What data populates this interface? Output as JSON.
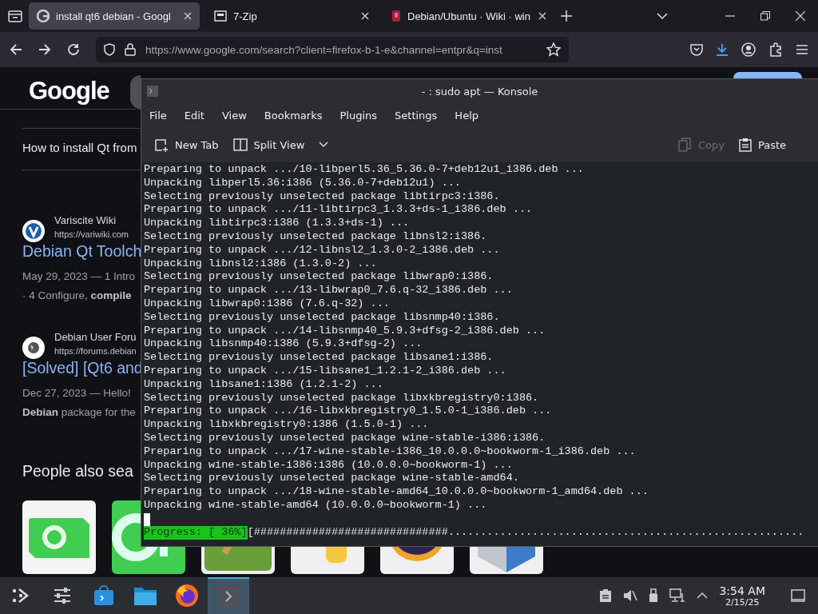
{
  "browser": {
    "tabs": [
      {
        "label": "install qt6 debian - Googl",
        "selected": true
      },
      {
        "label": "7-Zip",
        "selected": false
      },
      {
        "label": "Debian/Ubuntu · Wiki · win",
        "selected": false
      }
    ],
    "url": "https://www.google.com/search?client=firefox-b-1-e&channel=entpr&q=inst"
  },
  "google": {
    "logo": "Google",
    "snippet_heading": "How to install Qt from",
    "results": [
      {
        "site": "Variscite Wiki",
        "url": "https://variwiki.com",
        "title": "Debian Qt Toolch",
        "lines": [
          "May 29, 2023 — 1 Intro",
          "· 4 Configure, **compile**"
        ]
      },
      {
        "site": "Debian User Foru",
        "url": "https://forums.debian",
        "title": "[Solved] [Qt6 and",
        "lines": [
          "Dec 27, 2023 — Hello!",
          "**Debian** package for the"
        ]
      }
    ],
    "people_heading": "People also sea"
  },
  "konsole": {
    "title": "- : sudo apt — Konsole",
    "menu": [
      "File",
      "Edit",
      "View",
      "Bookmarks",
      "Plugins",
      "Settings",
      "Help"
    ],
    "toolbar": [
      {
        "label": "New Tab",
        "disabled": false
      },
      {
        "label": "Split View",
        "disabled": false
      },
      {
        "label": "Copy",
        "disabled": true
      },
      {
        "label": "Paste",
        "disabled": false
      }
    ],
    "lines": [
      "Preparing to unpack .../10-libperl5.36_5.36.0-7+deb12u1_i386.deb ...",
      "Unpacking libperl5.36:i386 (5.36.0-7+deb12u1) ...",
      "Selecting previously unselected package libtirpc3:i386.",
      "Preparing to unpack .../11-libtirpc3_1.3.3+ds-1_i386.deb ...",
      "Unpacking libtirpc3:i386 (1.3.3+ds-1) ...",
      "Selecting previously unselected package libnsl2:i386.",
      "Preparing to unpack .../12-libnsl2_1.3.0-2_i386.deb ...",
      "Unpacking libnsl2:i386 (1.3.0-2) ...",
      "Selecting previously unselected package libwrap0:i386.",
      "Preparing to unpack .../13-libwrap0_7.6.q-32_i386.deb ...",
      "Unpacking libwrap0:i386 (7.6.q-32) ...",
      "Selecting previously unselected package libsnmp40:i386.",
      "Preparing to unpack .../14-libsnmp40_5.9.3+dfsg-2_i386.deb ...",
      "Unpacking libsnmp40:i386 (5.9.3+dfsg-2) ...",
      "Selecting previously unselected package libsane1:i386.",
      "Preparing to unpack .../15-libsane1_1.2.1-2_i386.deb ...",
      "Unpacking libsane1:i386 (1.2.1-2) ...",
      "Selecting previously unselected package libxkbregistry0:i386.",
      "Preparing to unpack .../16-libxkbregistry0_1.5.0-1_i386.deb ...",
      "Unpacking libxkbregistry0:i386 (1.5.0-1) ...",
      "Selecting previously unselected package wine-stable-i386:i386.",
      "Preparing to unpack .../17-wine-stable-i386_10.0.0.0~bookworm-1_i386.deb ...",
      "Unpacking wine-stable-i386:i386 (10.0.0.0~bookworm-1) ...",
      "Selecting previously unselected package wine-stable-amd64.",
      "Preparing to unpack .../18-wine-stable-amd64_10.0.0.0~bookworm-1_amd64.deb ...",
      "Unpacking wine-stable-amd64 (10.0.0.0~bookworm-1) ..."
    ],
    "progress": {
      "label": "Progress: [ 36%]",
      "bar": "[##############################......................................................."
    }
  },
  "taskbar": {
    "apps": [
      {
        "active": false
      },
      {
        "active": false
      },
      {
        "active": false
      },
      {
        "active": false
      },
      {
        "active": false
      },
      {
        "active": true
      }
    ],
    "time": "3:54 AM",
    "date": "2/15/25"
  }
}
